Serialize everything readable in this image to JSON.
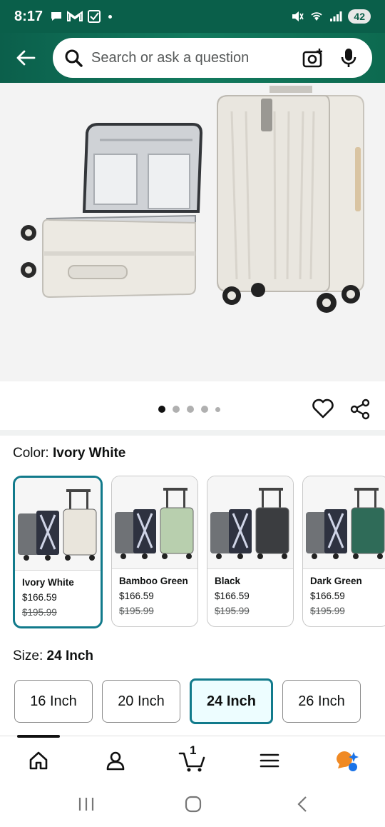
{
  "status": {
    "time": "8:17",
    "battery": "42"
  },
  "search": {
    "placeholder": "Search or ask a question"
  },
  "product": {
    "color_label": "Color:",
    "color_value": "Ivory White",
    "size_label": "Size:",
    "size_value": "24 Inch"
  },
  "carousel": {
    "image_count": 5,
    "active_index": 0
  },
  "colors": [
    {
      "name": "Ivory White",
      "price": "$166.59",
      "list_price": "$195.99",
      "selected": true,
      "swatch": "#e9e5dc"
    },
    {
      "name": "Bamboo Green",
      "price": "$166.59",
      "list_price": "$195.99",
      "selected": false,
      "swatch": "#b8cfae"
    },
    {
      "name": "Black",
      "price": "$166.59",
      "list_price": "$195.99",
      "selected": false,
      "swatch": "#3b3d40"
    },
    {
      "name": "Dark Green",
      "price": "$166.59",
      "list_price": "$195.99",
      "selected": false,
      "swatch": "#2f6b58"
    }
  ],
  "sizes": [
    {
      "label": "16 Inch",
      "selected": false
    },
    {
      "label": "20 Inch",
      "selected": false
    },
    {
      "label": "24 Inch",
      "selected": true
    },
    {
      "label": "26 Inch",
      "selected": false
    }
  ],
  "nav": {
    "cart_count": "1",
    "items": [
      "home-icon",
      "account-icon",
      "cart-icon",
      "menu-icon",
      "rufus-icon"
    ]
  },
  "theme": {
    "header_green": "#0b5f4b",
    "selected_border": "#117a8b",
    "selected_bg": "#edfdff",
    "rufus_orange": "#f08a24",
    "rufus_blue": "#1a73e8"
  }
}
